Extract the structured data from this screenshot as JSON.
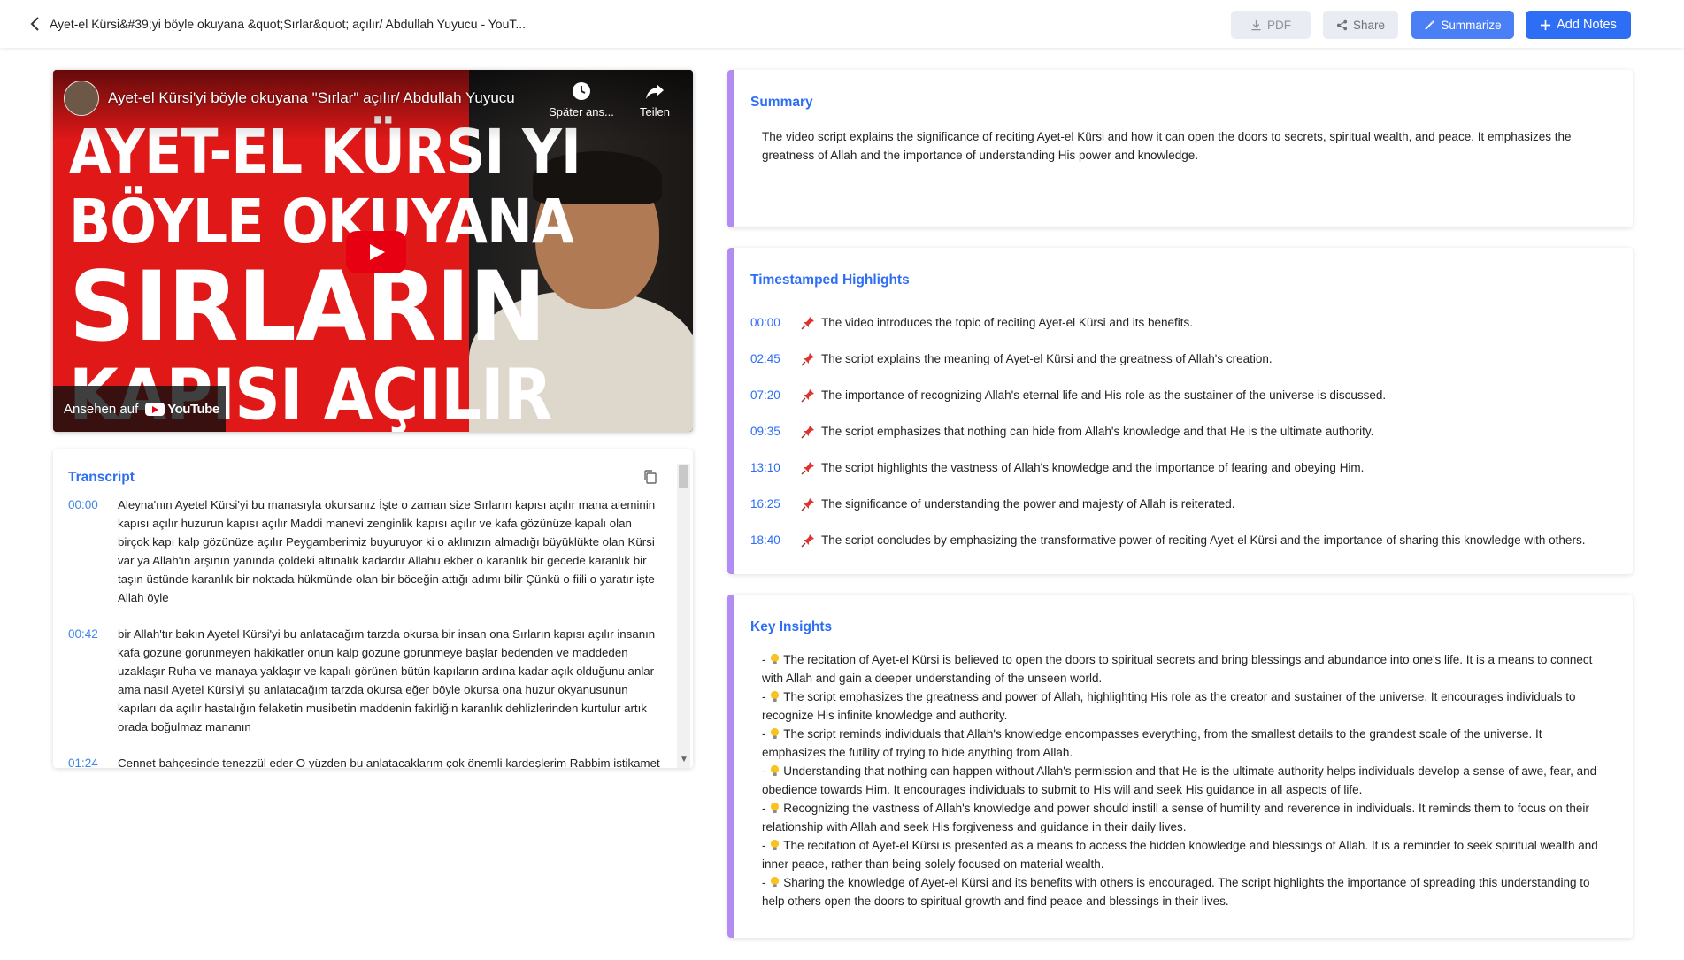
{
  "header": {
    "title": "Ayet-el Kürsi&#39;yi böyle okuyana &quot;Sırlar&quot; açılır/ Abdullah Yuyucu - YouT...",
    "pdf_label": "PDF",
    "share_label": "Share",
    "summarize_label": "Summarize",
    "add_notes_label": "Add Notes"
  },
  "video": {
    "title": "Ayet-el Kürsi'yi böyle okuyana \"Sırlar\" açılır/ Abdullah Yuyucu",
    "thumb_line1": "AYET-EL KÜRSI YI",
    "thumb_line2": "BÖYLE OKUYANA",
    "thumb_line3": "SIRLARIN",
    "thumb_line4": "KAPISI AÇILIR",
    "watch_later_label": "Später ans...",
    "share_label": "Teilen",
    "watch_on_label": "Ansehen auf",
    "youtube_label": "YouTube"
  },
  "transcript": {
    "heading": "Transcript",
    "entries": [
      {
        "time": "00:00",
        "text": "Aleyna'nın Ayetel Kürsi'yi bu manasıyla okursanız İşte o zaman size Sırların kapısı açılır mana aleminin kapısı açılır huzurun kapısı açılır Maddi manevi zenginlik kapısı açılır ve kafa gözünüze kapalı olan birçok kapı kalp gözünüze açılır Peygamberimiz buyuruyor ki o aklınızın almadığı büyüklükte olan Kürsi var ya Allah'ın arşının yanında çöldeki altınalık kadardır Allahu ekber o karanlık bir gecede karanlık bir taşın üstünde karanlık bir noktada hükmünde olan bir böceğin attığı adımı bilir Çünkü o fiili o yaratır işte Allah öyle"
      },
      {
        "time": "00:42",
        "text": "bir Allah'tır bakın Ayetel Kürsi'yi bu anlatacağım tarzda okursa bir insan ona Sırların kapısı açılır insanın kafa gözüne görünmeyen hakikatler onun kalp gözüne görünmeye başlar bedenden ve maddeden uzaklaşır Ruha ve manaya yaklaşır ve kapalı görünen bütün kapıların ardına kadar açık olduğunu anlar ama nasıl Ayetel Kürsi'yi şu anlatacağım tarzda okursa eğer böyle okursa ona huzur okyanusunun kapıları da açılır hastalığın felaketin musibetin maddenin fakirliğin karanlık dehlizlerinden kurtulur artık orada boğulmaz mananın"
      },
      {
        "time": "01:24",
        "text": "Cennet bahçesinde tenezzül eder O yüzden bu anlatacaklarım çok önemli kardeşlerim Rabbim istikamet versin"
      }
    ]
  },
  "summary": {
    "heading": "Summary",
    "text": "The video script explains the significance of reciting Ayet-el Kürsi and how it can open the doors to secrets, spiritual wealth, and peace. It emphasizes the greatness of Allah and the importance of understanding His power and knowledge."
  },
  "highlights": {
    "heading": "Timestamped Highlights",
    "items": [
      {
        "time": "00:00",
        "text": "The video introduces the topic of reciting Ayet-el Kürsi and its benefits."
      },
      {
        "time": "02:45",
        "text": "The script explains the meaning of Ayet-el Kürsi and the greatness of Allah's creation."
      },
      {
        "time": "07:20",
        "text": "The importance of recognizing Allah's eternal life and His role as the sustainer of the universe is discussed."
      },
      {
        "time": "09:35",
        "text": "The script emphasizes that nothing can hide from Allah's knowledge and that He is the ultimate authority."
      },
      {
        "time": "13:10",
        "text": "The script highlights the vastness of Allah's knowledge and the importance of fearing and obeying Him."
      },
      {
        "time": "16:25",
        "text": "The significance of understanding the power and majesty of Allah is reiterated."
      },
      {
        "time": "18:40",
        "text": "The script concludes by emphasizing the transformative power of reciting Ayet-el Kürsi and the importance of sharing this knowledge with others."
      }
    ]
  },
  "insights": {
    "heading": "Key Insights",
    "items": [
      "The recitation of Ayet-el Kürsi is believed to open the doors to spiritual secrets and bring blessings and abundance into one's life. It is a means to connect with Allah and gain a deeper understanding of the unseen world.",
      "The script emphasizes the greatness and power of Allah, highlighting His role as the creator and sustainer of the universe. It encourages individuals to recognize His infinite knowledge and authority.",
      "The script reminds individuals that Allah's knowledge encompasses everything, from the smallest details to the grandest scale of the universe. It emphasizes the futility of trying to hide anything from Allah.",
      "Understanding that nothing can happen without Allah's permission and that He is the ultimate authority helps individuals develop a sense of awe, fear, and obedience towards Him. It encourages individuals to submit to His will and seek His guidance in all aspects of life.",
      "Recognizing the vastness of Allah's knowledge and power should instill a sense of humility and reverence in individuals. It reminds them to focus on their relationship with Allah and seek His forgiveness and guidance in their daily lives.",
      "The recitation of Ayet-el Kürsi is presented as a means to access the hidden knowledge and blessings of Allah. It is a reminder to seek spiritual wealth and inner peace, rather than being solely focused on material wealth.",
      "Sharing the knowledge of Ayet-el Kürsi and its benefits with others is encouraged. The script highlights the importance of spreading this understanding to help others open the doors to spiritual growth and find peace and blessings in their lives."
    ]
  },
  "colors": {
    "accent": "#2d6ef5",
    "card_border": "#b18cf2",
    "video_red": "#e01818"
  }
}
